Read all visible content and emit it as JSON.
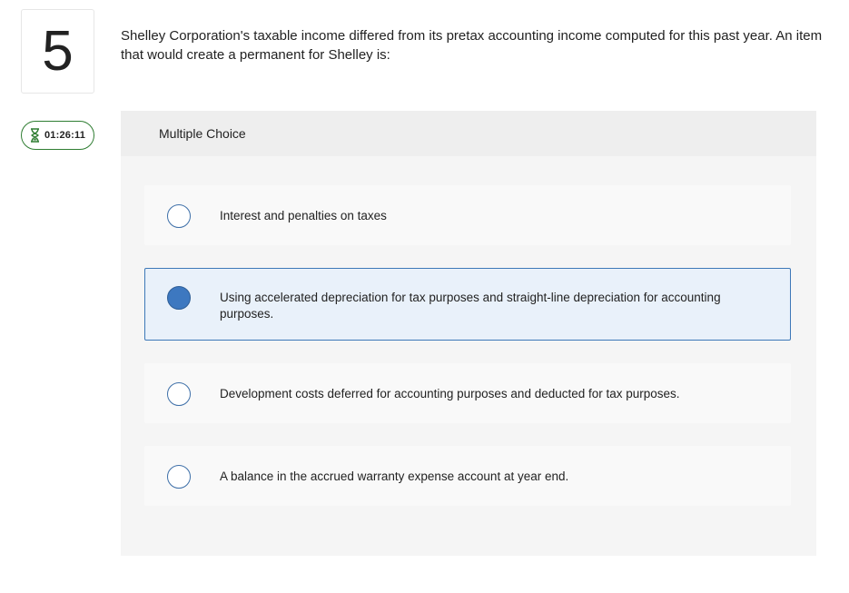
{
  "question": {
    "number": "5",
    "timer": "01:26:11",
    "text": "Shelley Corporation's taxable income differed from its pretax accounting income computed for this past year. An item that would create a permanent for Shelley is:"
  },
  "panel": {
    "header_label": "Multiple Choice",
    "options": [
      {
        "text": "Interest and penalties on taxes",
        "selected": false
      },
      {
        "text": "Using accelerated depreciation for tax purposes and straight-line depreciation for accounting purposes.",
        "selected": true
      },
      {
        "text": "Development costs deferred for accounting purposes and deducted for tax purposes.",
        "selected": false
      },
      {
        "text": "A balance in the accrued warranty expense account at year end.",
        "selected": false
      }
    ]
  },
  "icons": {
    "timer": "hourglass-icon"
  },
  "colors": {
    "selected_border": "#3d78b8",
    "selected_background": "#e9f1fa",
    "radio_fill": "#3d78c0",
    "timer_border": "#2f7d32"
  }
}
